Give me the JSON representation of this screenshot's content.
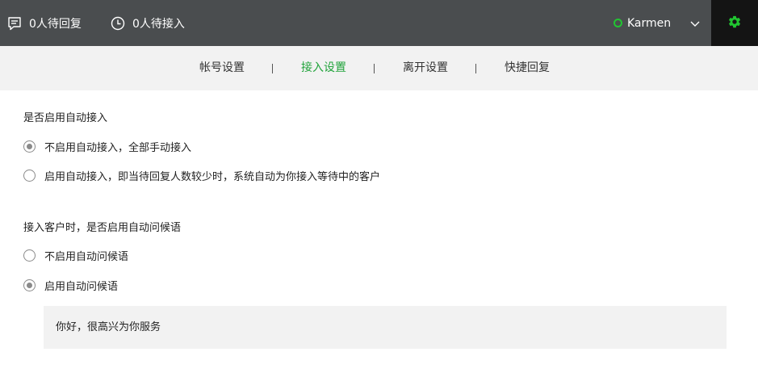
{
  "topbar": {
    "pending_reply": "0人待回复",
    "pending_access": "0人待接入",
    "user_name": "Karmen",
    "status_color": "#21c531",
    "icons": {
      "reply": "message-square-icon",
      "access": "clock-icon",
      "dropdown": "chevron-down-icon",
      "settings": "gear-icon"
    }
  },
  "tabs": [
    {
      "label": "帐号设置",
      "active": false
    },
    {
      "label": "接入设置",
      "active": true
    },
    {
      "label": "离开设置",
      "active": false
    },
    {
      "label": "快捷回复",
      "active": false
    }
  ],
  "accent_color": "#21a33b",
  "auto_access": {
    "title": "是否启用自动接入",
    "options": [
      {
        "label": "不启用自动接入，全部手动接入",
        "checked": true
      },
      {
        "label": "启用自动接入，即当待回复人数较少时，系统自动为你接入等待中的客户",
        "checked": false
      }
    ]
  },
  "auto_greeting": {
    "title": "接入客户时，是否启用自动问候语",
    "options": [
      {
        "label": "不启用自动问候语",
        "checked": false
      },
      {
        "label": "启用自动问候语",
        "checked": true
      }
    ],
    "greeting_text": "你好，很高兴为你服务"
  }
}
